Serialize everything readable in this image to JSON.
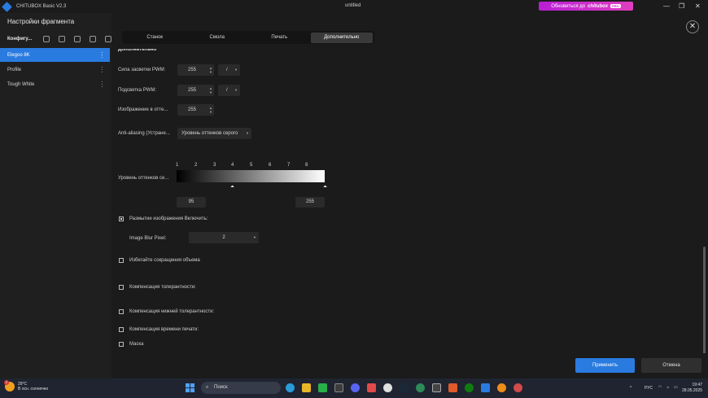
{
  "titlebar": {
    "app_title": "CHITUBOX Basic V2.3",
    "doc_title": "untitled",
    "upgrade_prefix": "Обновиться до",
    "upgrade_brand": "chitubox",
    "upgrade_badge": "PRO",
    "min": "—",
    "max": "❐",
    "close": "✕"
  },
  "sidebar": {
    "title": "Настройки фрагмента",
    "toolbar_label": "Конфигу...",
    "items": [
      {
        "label": "Elegoo 8K",
        "active": true
      },
      {
        "label": "Profile",
        "active": false
      },
      {
        "label": "Tough White",
        "active": false
      }
    ]
  },
  "tabs": [
    {
      "label": "Станок",
      "active": false
    },
    {
      "label": "Смола",
      "active": false
    },
    {
      "label": "Печать",
      "active": false
    },
    {
      "label": "Дополнительно",
      "active": true
    }
  ],
  "section": {
    "title": "Дополнительно"
  },
  "settings": {
    "pwm_power": {
      "label": "Сила засветки PWM:",
      "value": "255",
      "unit": "/"
    },
    "pwm_light": {
      "label": "Подсветка PWM:",
      "value": "255",
      "unit": "/"
    },
    "gray_image": {
      "label": "Изображение в отте...",
      "value": "255"
    },
    "anti_aliasing": {
      "label": "Anti-aliasing (Устране...",
      "value": "Уровень оттенков серого"
    },
    "gray_level": {
      "label": "Уровень оттенков се...",
      "scale": [
        "1",
        "2",
        "3",
        "4",
        "5",
        "6",
        "7",
        "8"
      ],
      "marker_left": "⏶",
      "marker_right": "⏶",
      "min_value": "95",
      "max_value": "255"
    },
    "blur": {
      "label": "Размытие изображения Включить:",
      "checked": true
    },
    "blur_pixel": {
      "label": "Image Blur Pixel:",
      "value": "2"
    },
    "avoid_shrink": {
      "label": "Избегайте сокращения объема",
      "checked": false
    },
    "tolerance": {
      "label": "Компенсация толерантности:",
      "checked": false
    },
    "lower_tolerance": {
      "label": "Компенсация нижней толерантности:",
      "checked": false
    },
    "time_comp": {
      "label": "Компенсация времени печати:",
      "checked": false
    },
    "mask": {
      "label": "Маска",
      "checked": false
    }
  },
  "buttons": {
    "apply": "Применить",
    "cancel": "Отмена",
    "close_symbol": "✕"
  },
  "taskbar": {
    "temperature": "29°C",
    "weather": "В осн. солнечно",
    "weather_badge": "2",
    "search_placeholder": "Поиск",
    "lang": "РУС",
    "time": "19:47",
    "date": "28.05.2025",
    "caret": "^"
  },
  "colors": {
    "accent": "#2a7be0",
    "upgrade": "#d42bc8"
  }
}
